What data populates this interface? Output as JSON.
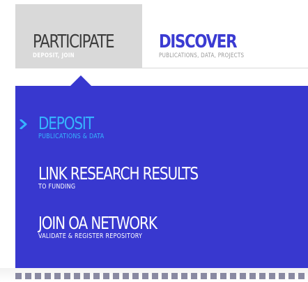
{
  "tabs": [
    {
      "label": "PARTICIPATE",
      "sublabel": "DEPOSIT, JOIN",
      "active": true
    },
    {
      "label": "DISCOVER",
      "sublabel": "PUBLICATIONS, DATA, PROJECTS",
      "active": false
    }
  ],
  "menu": {
    "items": [
      {
        "title": "DEPOSIT",
        "subtitle": "PUBLICATIONS & DATA",
        "active": true
      },
      {
        "title": "LINK RESEARCH RESULTS",
        "subtitle": "TO FUNDING",
        "active": false
      },
      {
        "title": "JOIN OA NETWORK",
        "subtitle": "VALIDATE & REGISTER REPOSITORY",
        "active": false
      }
    ]
  },
  "colors": {
    "dropdown_bg": "#3838cf",
    "active_tab_bg": "#d9d9d9",
    "active_item": "#36b4ff",
    "discover_label": "#3b3bd2"
  },
  "icons": {
    "active_indicator": "chevron-right-icon"
  }
}
